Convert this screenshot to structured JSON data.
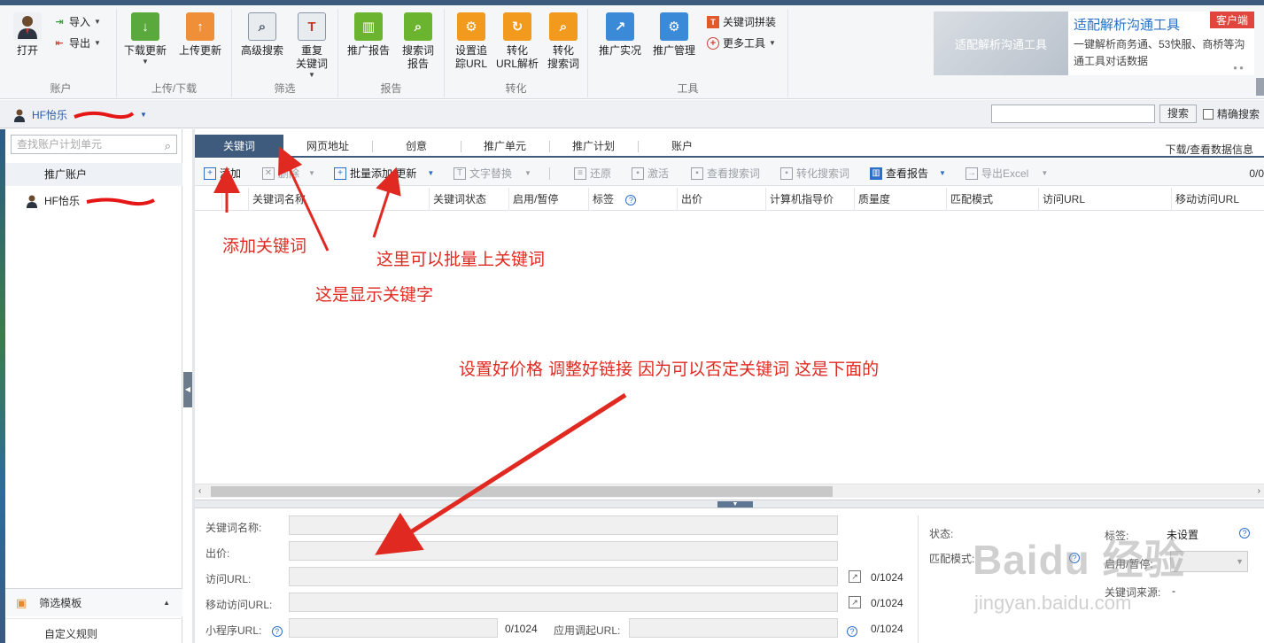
{
  "ribbon": {
    "groups": {
      "account": "账户",
      "upload_download": "上传/下载",
      "filter": "筛选",
      "report": "报告",
      "convert": "转化",
      "tools": "工具"
    },
    "open": "打开",
    "import": "导入",
    "export": "导出",
    "download_update": "下载更新",
    "upload_update": "上传更新",
    "advanced_search": "高级搜索",
    "duplicate_kw_1": "重复",
    "duplicate_kw_2": "关键词",
    "promo_report": "推广报告",
    "search_term_report_1": "搜索词",
    "search_term_report_2": "报告",
    "tracking_url_1": "设置追",
    "tracking_url_2": "踪URL",
    "convert_url_1": "转化",
    "convert_url_2": "URL解析",
    "convert_search_1": "转化",
    "convert_search_2": "搜索词",
    "promo_live": "推广实况",
    "promo_manage": "推广管理",
    "kw_combine": "关键词拼装",
    "more_tools": "更多工具"
  },
  "ad": {
    "image_caption": "适配解析沟通工具",
    "title": "适配解析沟通工具",
    "tag": "客户端",
    "desc": "一键解析商务通、53快服、商桥等沟通工具对话数据"
  },
  "account_bar": {
    "name": "HF怡乐",
    "search_button": "搜索",
    "exact_search": "精确搜索"
  },
  "sidebar": {
    "search_placeholder": "查找账户计划单元",
    "header": "推广账户",
    "account_item": "HF怡乐",
    "filter_template": "筛选模板",
    "custom_rules": "自定义规则"
  },
  "tabs": [
    "关键词",
    "网页地址",
    "创意",
    "推广单元",
    "推广计划",
    "账户"
  ],
  "tabs_right": "下载/查看数据信息",
  "toolbar": {
    "add": "添加",
    "delete": "删除",
    "batch_add": "批量添加/更新",
    "text_replace": "文字替换",
    "restore": "还原",
    "activate": "激活",
    "view_search_terms": "查看搜索词",
    "convert_search_terms": "转化搜索词",
    "view_report": "查看报告",
    "export_excel": "导出Excel",
    "pager": "0/0"
  },
  "grid_columns": [
    "关键词名称",
    "关键词状态",
    "启用/暂停",
    "标签",
    "出价",
    "计算机指导价",
    "质量度",
    "匹配模式",
    "访问URL",
    "移动访问URL"
  ],
  "detail": {
    "kw_name": "关键词名称:",
    "bid": "出价:",
    "visit_url": "访问URL:",
    "mobile_url": "移动访问URL:",
    "mini_program_url": "小程序URL:",
    "app_url": "应用调起URL:",
    "count": "0/1024",
    "status": "状态:",
    "tag": "标签:",
    "tag_value": "未设置",
    "match_mode": "匹配模式:",
    "enable_pause": "启用/暂停:",
    "kw_source": "关键词来源:",
    "kw_source_value": "-"
  },
  "annotations": {
    "add_kw": "添加关键词",
    "batch": "这里可以批量上关键词",
    "shows_kw": "这是显示关键字",
    "set_price": "设置好价格 调整好链接 因为可以否定关键词  这是下面的"
  },
  "watermark": {
    "big": "Baidu 经验",
    "small": "jingyan.baidu.com"
  },
  "colors": {
    "accent": "#3e5b7d",
    "annotation": "#e02a21",
    "link_blue": "#2a71c4"
  }
}
